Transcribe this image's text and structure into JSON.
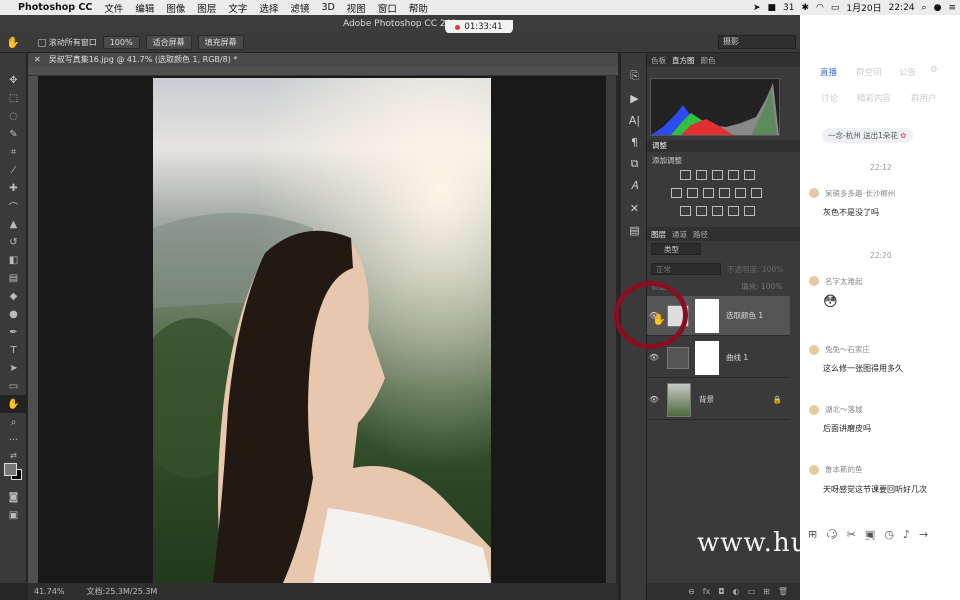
{
  "menubar": {
    "app": "Photoshop CC",
    "items": [
      "文件",
      "编辑",
      "图像",
      "图层",
      "文字",
      "选择",
      "滤镜",
      "3D",
      "视图",
      "窗口",
      "帮助"
    ],
    "battery": "31",
    "date": "1月20日",
    "time": "22:24"
  },
  "window": {
    "title": "Adobe Photoshop CC 201",
    "recording": "01:33:41"
  },
  "options": {
    "scroll_all": "滚动所有窗口",
    "zoom": "100%",
    "fit": "适合屏幕",
    "fill": "填充屏幕",
    "workspace": "摄影"
  },
  "document": {
    "tab": "吴叔写真集16.jpg @ 41.7% (选取颜色 1, RGB/8) *",
    "zoom": "41.74%",
    "doc_size": "文档:25.3M/25.3M"
  },
  "panels": {
    "color_tabs": [
      "色板",
      "直方图",
      "颜色"
    ],
    "adjust_title": "调整",
    "adjust_add": "添加调整",
    "layer_tabs": [
      "图层",
      "通道",
      "路径"
    ],
    "kind": "类型",
    "blend": "正常",
    "opacity_label": "不透明度:",
    "opacity": "100%",
    "lock_label": "锁定:",
    "fill_label": "填充:",
    "fill": "100%",
    "layers": [
      {
        "name": "选取颜色 1"
      },
      {
        "name": "曲线 1"
      },
      {
        "name": "背景"
      }
    ]
  },
  "chat": {
    "tabs": [
      "直播",
      "群空间",
      "公告"
    ],
    "subtabs": [
      "讨论",
      "精彩内容",
      "群用户"
    ],
    "gift": "一念-杭州 送出1朵花",
    "messages": [
      {
        "time": "22:12",
        "name": "呆萌多多趣-长沙郴州",
        "text": "灰色不是没了吗"
      },
      {
        "time": "22:20",
        "name": "名字太难起",
        "text": "😳"
      },
      {
        "name": "兔兔～石家庄",
        "text": "这么修一张图得用多久"
      },
      {
        "name": "湖北～落城",
        "text": "后面讲磨皮吗"
      },
      {
        "name": "鲁本斯的鱼",
        "text": "天呀感觉这节课要回听好几次"
      }
    ]
  },
  "watermark": "www.hunls.com"
}
